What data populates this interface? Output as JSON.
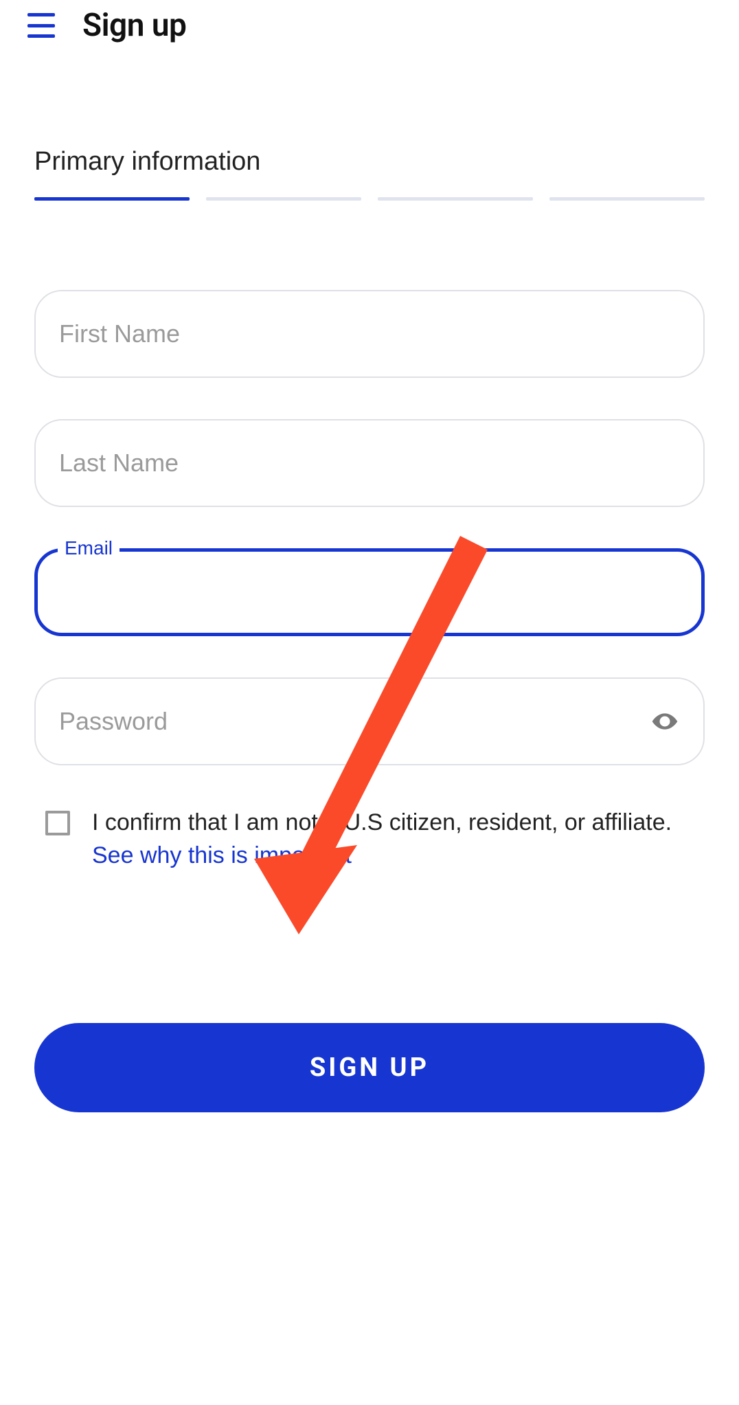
{
  "header": {
    "title": "Sign up"
  },
  "section": {
    "title": "Primary information",
    "progress_total": 4,
    "progress_active_index": 0
  },
  "form": {
    "first_name": {
      "placeholder": "First Name",
      "value": ""
    },
    "last_name": {
      "placeholder": "Last Name",
      "value": ""
    },
    "email": {
      "label": "Email",
      "value": ""
    },
    "password": {
      "placeholder": "Password",
      "value": ""
    }
  },
  "confirmation": {
    "text_before_link": "I confirm that I am not a U.S citizen, resident, or affiliate. ",
    "link_text": "See why this is important"
  },
  "buttons": {
    "signup": "SIGN UP"
  },
  "colors": {
    "accent": "#1735d0",
    "arrow": "#fa4a2a"
  }
}
